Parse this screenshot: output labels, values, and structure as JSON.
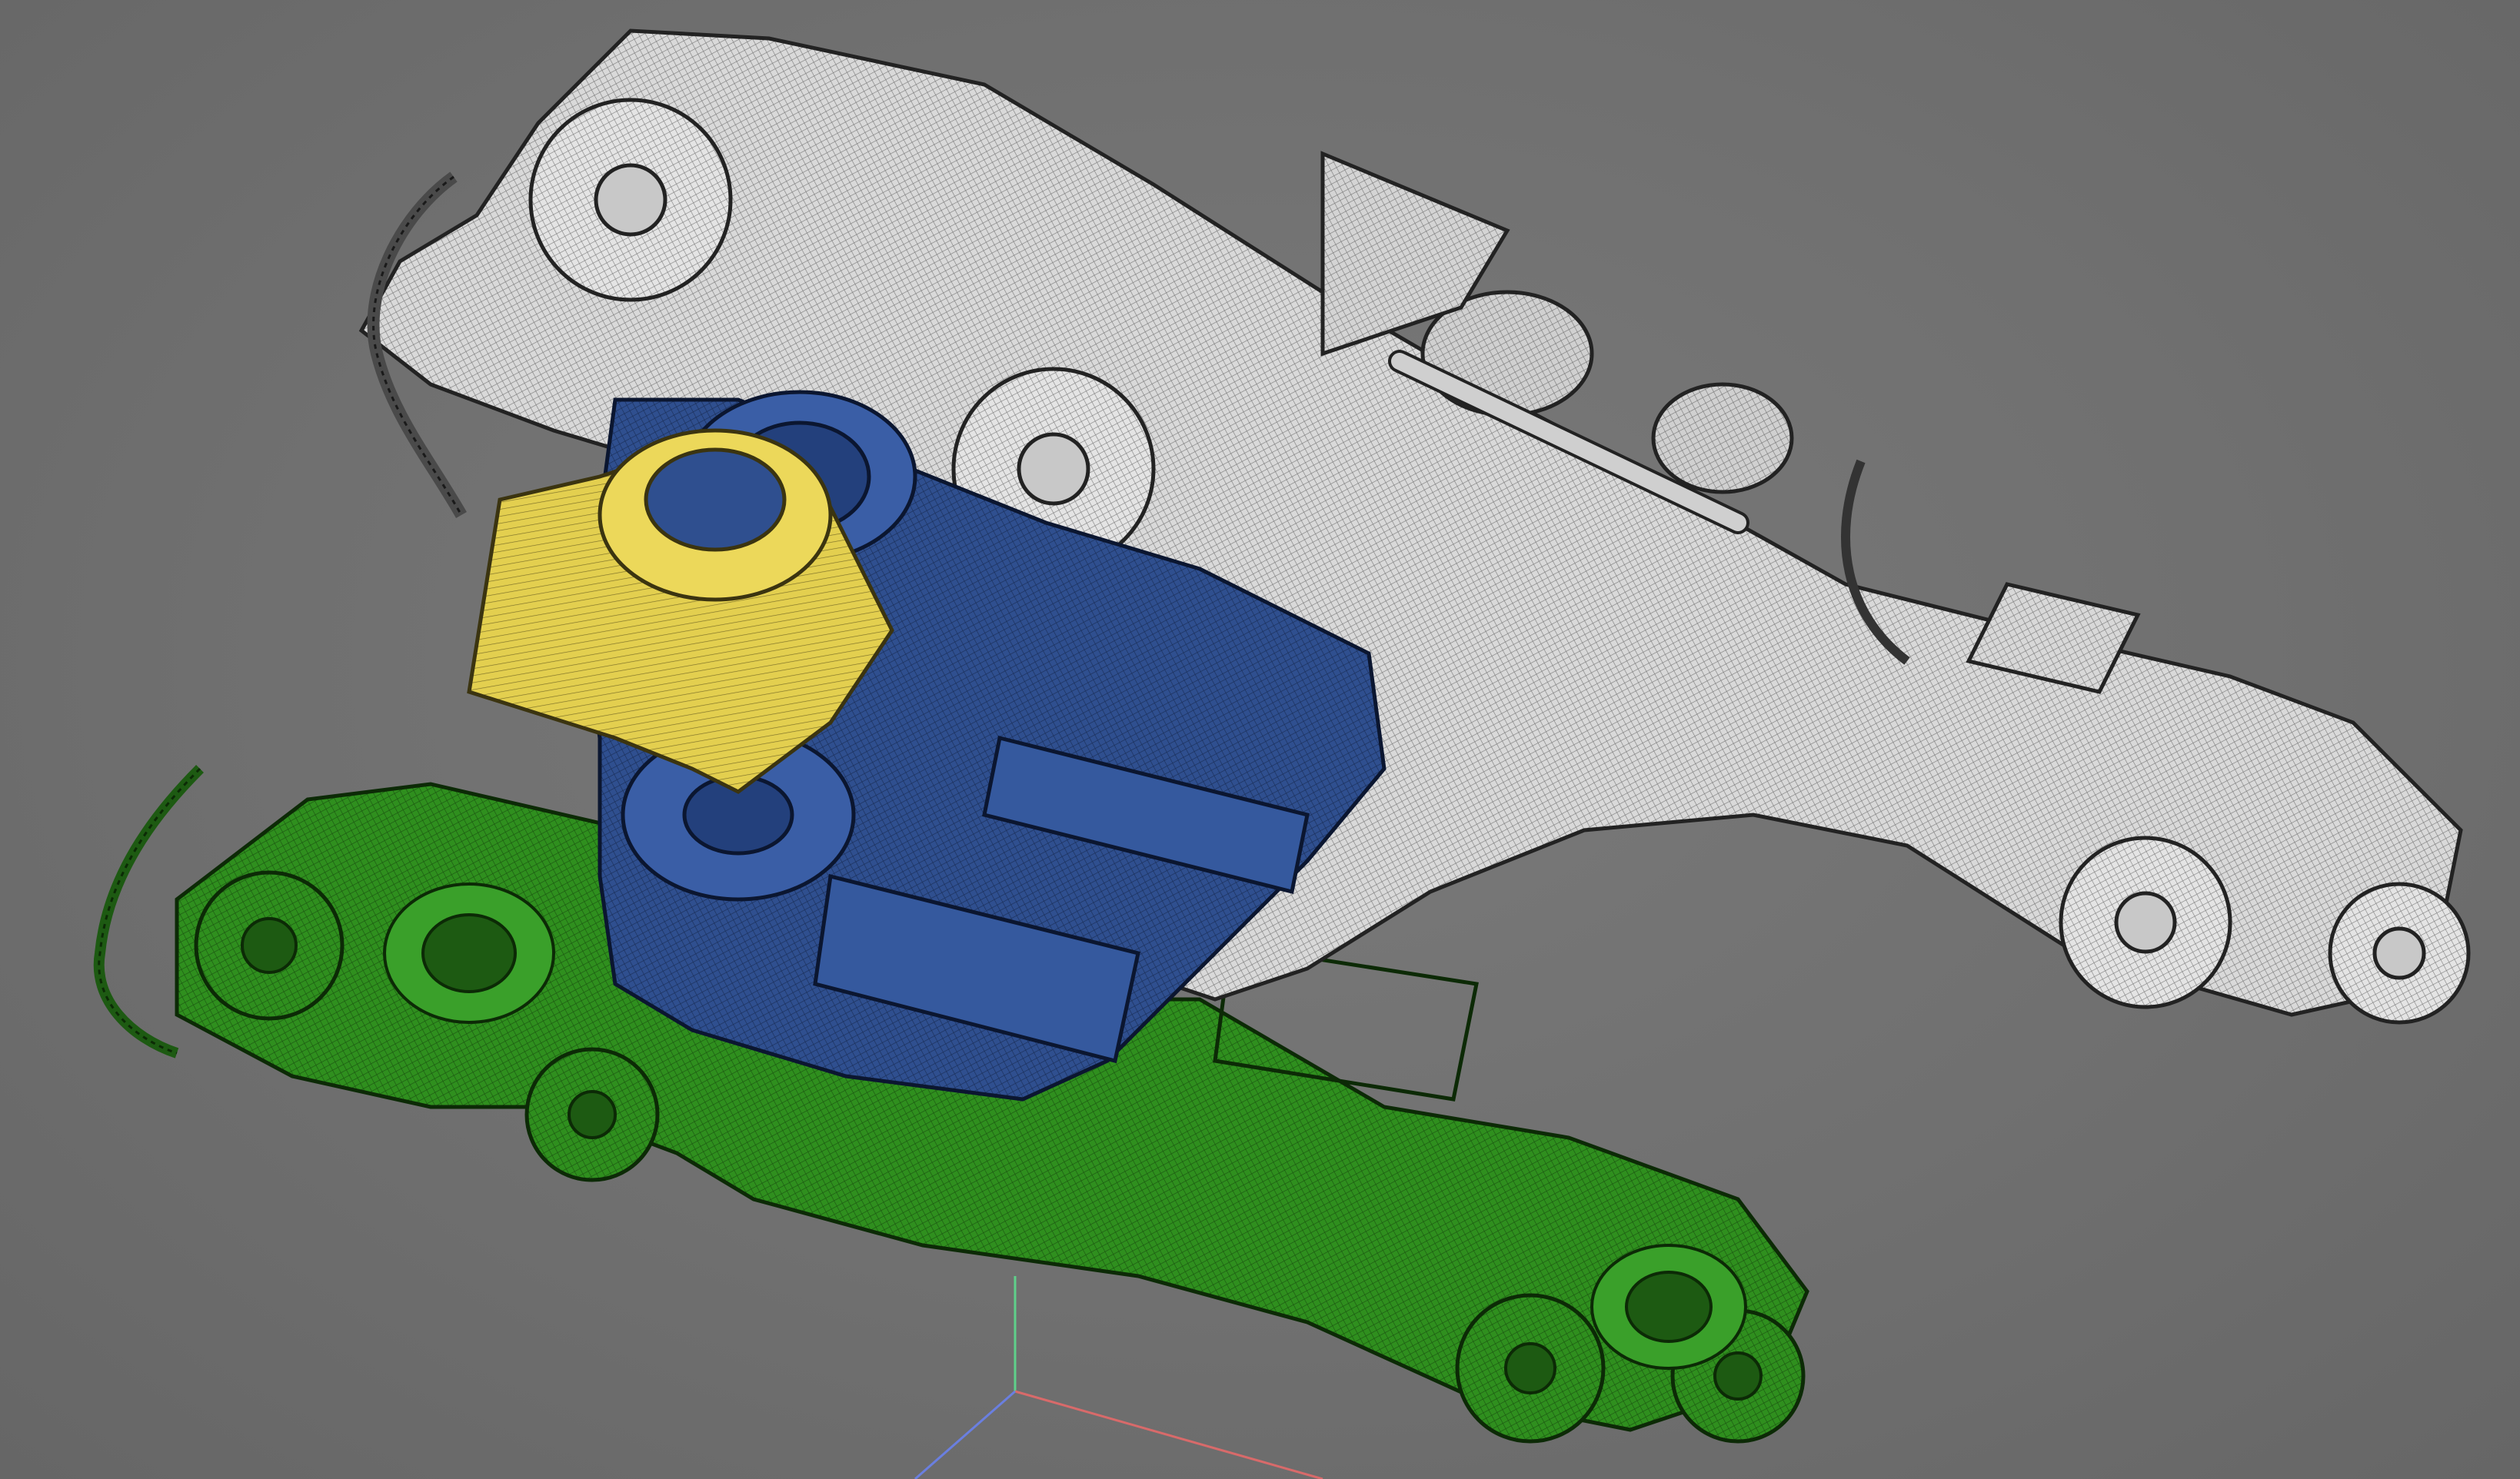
{
  "viewport": {
    "background_color": "#6f6f6f",
    "view_mode": "wireframe-on-shaded"
  },
  "model": {
    "parts": [
      {
        "id": "frame",
        "color": "#d9d9d9"
      },
      {
        "id": "lower-frame",
        "color": "#2f8f1e"
      },
      {
        "id": "motor",
        "color": "#2f4f8f"
      },
      {
        "id": "gearbox",
        "color": "#e3cf4f"
      }
    ]
  },
  "axis_gizmo": {
    "x_color": "#d86a6a",
    "y_color": "#5fd08a",
    "z_color": "#6a7fe0"
  }
}
